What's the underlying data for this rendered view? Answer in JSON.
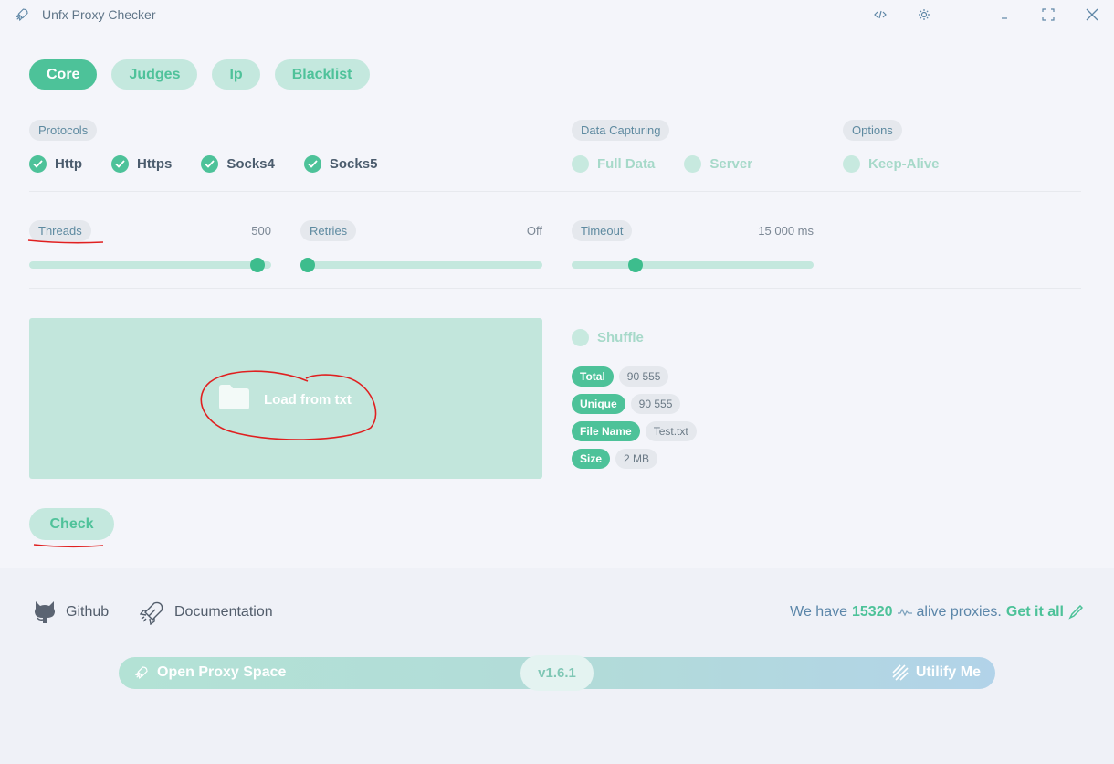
{
  "titlebar": {
    "title": "Unfx Proxy Checker",
    "icons": [
      "rocket-icon",
      "code-icon",
      "sun-icon",
      "minimize-icon",
      "maximize-icon",
      "close-icon"
    ]
  },
  "tabs": [
    {
      "label": "Core",
      "active": true
    },
    {
      "label": "Judges",
      "active": false
    },
    {
      "label": "Ip",
      "active": false
    },
    {
      "label": "Blacklist",
      "active": false
    }
  ],
  "protocols": {
    "title": "Protocols",
    "items": [
      {
        "label": "Http",
        "checked": true
      },
      {
        "label": "Https",
        "checked": true
      },
      {
        "label": "Socks4",
        "checked": true
      },
      {
        "label": "Socks5",
        "checked": true
      }
    ]
  },
  "capturing": {
    "title": "Data Capturing",
    "items": [
      {
        "label": "Full Data",
        "checked": false
      },
      {
        "label": "Server",
        "checked": false
      }
    ]
  },
  "options": {
    "title": "Options",
    "items": [
      {
        "label": "Keep-Alive",
        "checked": false
      }
    ]
  },
  "sliders": {
    "threads": {
      "label": "Threads",
      "value": "500",
      "level": 0.97
    },
    "retries": {
      "label": "Retries",
      "value": "Off",
      "level": 0.0
    },
    "timeout": {
      "label": "Timeout",
      "value": "15 000 ms",
      "level": 0.25
    }
  },
  "loader": {
    "label": "Load from txt"
  },
  "shuffle": {
    "label": "Shuffle",
    "checked": false
  },
  "stats": {
    "total": {
      "key": "Total",
      "value": "90 555"
    },
    "unique": {
      "key": "Unique",
      "value": "90 555"
    },
    "file_name": {
      "key": "File Name",
      "value": "Test.txt"
    },
    "size": {
      "key": "Size",
      "value": "2 MB"
    }
  },
  "check_label": "Check",
  "footer": {
    "github": "Github",
    "documentation": "Documentation",
    "alive_prefix": "We have",
    "alive_count": "15320",
    "alive_suffix": "alive proxies.",
    "get_all": "Get it all"
  },
  "banner": {
    "left": "Open Proxy Space",
    "version": "v1.6.1",
    "right": "Utilify Me"
  },
  "colors": {
    "accent": "#4dc299",
    "accent_light": "#c4e8de",
    "background": "#eff1f7",
    "annotation": "#e02020"
  }
}
